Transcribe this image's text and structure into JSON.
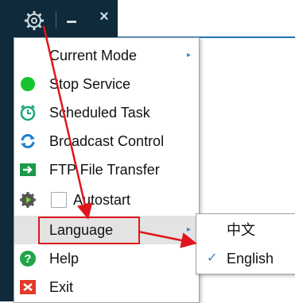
{
  "titlebar": {
    "settings_icon": "gear-icon",
    "minimize_icon": "minimize-icon",
    "close_label": "×"
  },
  "menu": {
    "items": [
      {
        "label": "Current Mode",
        "icon": "none",
        "has_submenu": true
      },
      {
        "label": "Stop Service",
        "icon": "green-dot-icon",
        "has_submenu": false
      },
      {
        "label": "Scheduled Task",
        "icon": "alarm-clock-icon",
        "has_submenu": false
      },
      {
        "label": "Broadcast Control",
        "icon": "refresh-icon",
        "has_submenu": false
      },
      {
        "label": "FTP File Transfer",
        "icon": "ftp-arrow-icon",
        "has_submenu": false
      },
      {
        "label": "Autostart",
        "icon": "gear-play-icon",
        "has_checkbox": true,
        "checked": false
      },
      {
        "label": "Language",
        "icon": "none",
        "has_submenu": true,
        "highlighted": true
      },
      {
        "label": "Help",
        "icon": "help-icon",
        "has_submenu": false
      },
      {
        "label": "Exit",
        "icon": "exit-icon",
        "has_submenu": false
      }
    ],
    "submenu_arrow": "▸"
  },
  "language_submenu": {
    "options": [
      {
        "label": "中文",
        "selected": false
      },
      {
        "label": "English",
        "selected": true
      }
    ],
    "check_mark": "✓"
  },
  "colors": {
    "titlebar_bg": "#0f2a3a",
    "annotation_red": "#e0161c",
    "accent_blue": "#2f88d0"
  }
}
